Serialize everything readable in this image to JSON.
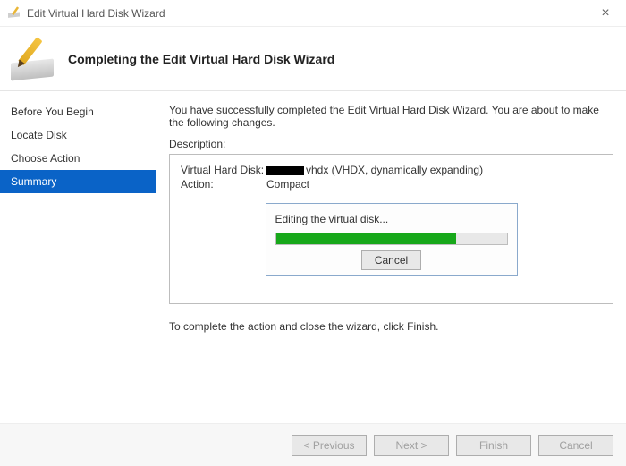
{
  "window": {
    "title": "Edit Virtual Hard Disk Wizard"
  },
  "header": {
    "heading": "Completing the Edit Virtual Hard Disk Wizard"
  },
  "sidebar": {
    "items": [
      {
        "label": "Before You Begin",
        "selected": false
      },
      {
        "label": "Locate Disk",
        "selected": false
      },
      {
        "label": "Choose Action",
        "selected": false
      },
      {
        "label": "Summary",
        "selected": true
      }
    ]
  },
  "content": {
    "intro": "You have successfully completed the Edit Virtual Hard Disk Wizard. You are about to make the following changes.",
    "description_label": "Description:",
    "vhd_key": "Virtual Hard Disk:",
    "vhd_value_suffix": "vhdx (VHDX, dynamically expanding)",
    "action_key": "Action:",
    "action_value": "Compact",
    "progress_label": "Editing the virtual disk...",
    "progress_percent": 78,
    "cancel_label": "Cancel",
    "complete_text": "To complete the action and close the wizard, click Finish."
  },
  "footer": {
    "previous": "< Previous",
    "next": "Next >",
    "finish": "Finish",
    "cancel": "Cancel"
  }
}
